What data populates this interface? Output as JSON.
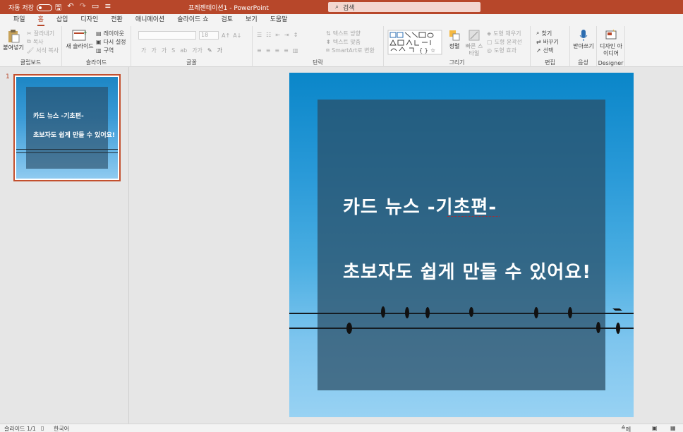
{
  "titlebar": {
    "autosave_label": "자동 저장",
    "autosave_state": "끔",
    "document_title": "프레젠테이션1 - PowerPoint",
    "search_placeholder": "검색"
  },
  "tabs": [
    "파일",
    "홈",
    "삽입",
    "디자인",
    "전환",
    "애니메이션",
    "슬라이드 쇼",
    "검토",
    "보기",
    "도움말"
  ],
  "active_tab": "홈",
  "ribbon": {
    "clipboard": {
      "label": "클립보드",
      "paste": "붙여넣기",
      "cut": "잘라내기",
      "copy": "복사",
      "format_painter": "서식 복사"
    },
    "slides": {
      "label": "슬라이드",
      "new_slide": "새 슬라이드",
      "layout": "레이아웃",
      "reset": "다시 설정",
      "section": "구역"
    },
    "font": {
      "label": "글꼴",
      "size": "18"
    },
    "paragraph": {
      "label": "단락",
      "text_direction": "텍스트 방향",
      "align_text": "텍스트 맞춤",
      "smartart": "SmartArt로 변환"
    },
    "drawing": {
      "label": "그리기",
      "arrange": "정렬",
      "quick_styles": "빠른 스타일",
      "shape_fill": "도형 채우기",
      "shape_outline": "도형 윤곽선",
      "shape_effects": "도형 효과"
    },
    "editing": {
      "label": "편집",
      "find": "찾기",
      "replace": "바꾸기",
      "select": "선택"
    },
    "voice": {
      "label": "음성",
      "dictate": "받아쓰기"
    },
    "designer": {
      "label": "Designer",
      "design_ideas": "디자인 아이디어"
    }
  },
  "thumbnail": {
    "number": "1",
    "title": "카드 뉴스 -기초편-",
    "subtitle": "초보자도 쉽게 만들 수 있어요!"
  },
  "slide": {
    "title": "카드 뉴스 -기초편-",
    "subtitle": "초보자도 쉽게 만들 수 있어요!"
  },
  "statusbar": {
    "slide_info": "슬라이드 1/1",
    "language": "한국어",
    "notes": "메모"
  },
  "colors": {
    "accent": "#b7472a",
    "sky_top": "#0a86c9",
    "sky_bottom": "#98d2f3"
  }
}
